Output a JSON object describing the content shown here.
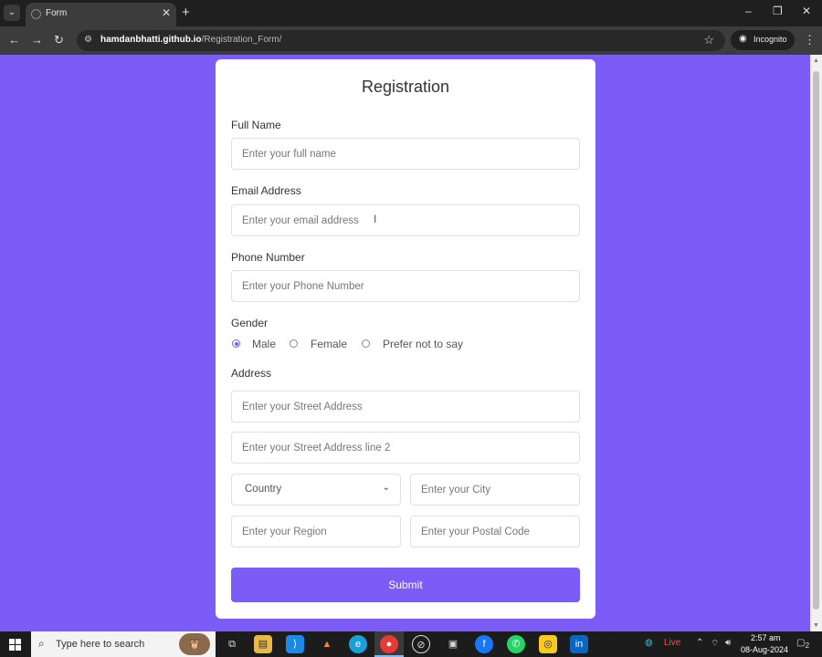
{
  "browser": {
    "tab_title": "Form",
    "url_host": "hamdanbhatti.github.io",
    "url_path": "/Registration_Form/",
    "incognito_label": "Incognito",
    "new_tab_glyph": "+",
    "close_glyph": "✕",
    "minimize_glyph": "–",
    "maximize_glyph": "❐",
    "back_glyph": "←",
    "forward_glyph": "→",
    "reload_glyph": "↻",
    "star_glyph": "☆",
    "kebab_glyph": "⋮",
    "tab_menu_glyph": "⌄"
  },
  "form": {
    "title": "Registration",
    "full_name": {
      "label": "Full Name",
      "placeholder": "Enter your full name"
    },
    "email": {
      "label": "Email Address",
      "placeholder": "Enter your email address"
    },
    "phone": {
      "label": "Phone Number",
      "placeholder": "Enter your Phone Number"
    },
    "gender": {
      "label": "Gender",
      "options": [
        "Male",
        "Female",
        "Prefer not to say"
      ],
      "selected": "Male"
    },
    "address": {
      "label": "Address",
      "street_placeholder": "Enter your Street Address",
      "street2_placeholder": "Enter your Street Address line 2",
      "country_value": "Country",
      "city_placeholder": "Enter your City",
      "region_placeholder": "Enter your Region",
      "postal_placeholder": "Enter your Postal Code"
    },
    "submit_label": "Submit",
    "chevron_glyph": "⌄",
    "cursor_glyph": "I"
  },
  "colors": {
    "background": "#7b5cf6",
    "accent": "#7b5cf6",
    "card": "#ffffff"
  },
  "taskbar": {
    "search_text": "Type here to search",
    "search_glyph": "⌕",
    "live_label": "Live",
    "time": "2:57 am",
    "date": "08-Aug-2024",
    "notification_count": "2",
    "icons": [
      "task-view-icon",
      "file-explorer-icon",
      "vscode-icon",
      "vlc-icon",
      "edge-icon",
      "chrome-icon",
      "app-icon",
      "media-icon",
      "facebook-icon",
      "whatsapp-icon",
      "app2-icon",
      "linkedin-icon"
    ]
  }
}
